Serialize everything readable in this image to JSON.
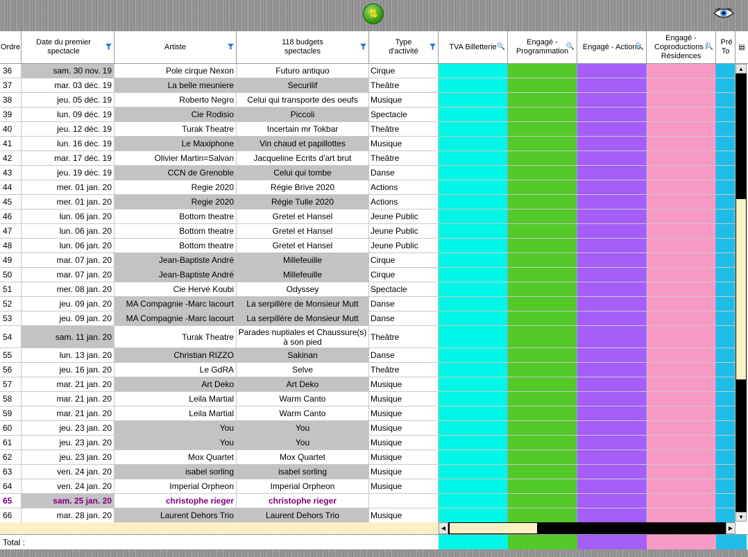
{
  "columns": {
    "ordre": "Ordre",
    "date": "Date du premier spectacle",
    "artiste": "Artiste",
    "budgets": "118 budgets spectacles",
    "type": "Type d'activité",
    "tva": "TVA Billetterie",
    "prog": "Engagé - Programmation",
    "actions": "Engagé - Actions",
    "coprod": "Engagé - Coproductions / Résidences",
    "pre": "Pré To"
  },
  "colors": {
    "tva": "#00f7e7",
    "prog": "#53c92a",
    "actions": "#a55ef7",
    "coprod": "#f79ac6",
    "pre": "#1ebde8"
  },
  "rows": [
    {
      "ordre": "36",
      "date": "sam. 30 nov. 19",
      "artiste": "Pole cirque Nexon",
      "budget": "Futuro antiquo",
      "type": "Cirque",
      "shade": "date"
    },
    {
      "ordre": "37",
      "date": "mar. 03 déc. 19",
      "artiste": "La belle meuniere",
      "budget": "Securilif",
      "type": "Theâtre",
      "shade": "ab"
    },
    {
      "ordre": "38",
      "date": "jeu. 05 déc. 19",
      "artiste": "Roberto Negro",
      "budget": "Celui qui transporte des oeufs",
      "type": "Musique",
      "shade": ""
    },
    {
      "ordre": "39",
      "date": "lun. 09 déc. 19",
      "artiste": "Cie Rodisio",
      "budget": "Piccoli",
      "type": "Spectacle",
      "shade": "ab"
    },
    {
      "ordre": "40",
      "date": "jeu. 12 déc. 19",
      "artiste": "Turak Theatre",
      "budget": "Incertain mr Tokbar",
      "type": "Theâtre",
      "shade": ""
    },
    {
      "ordre": "41",
      "date": "lun. 16 déc. 19",
      "artiste": "Le Maxiphone",
      "budget": "Vin chaud et papillottes",
      "type": "Musique",
      "shade": "ab"
    },
    {
      "ordre": "42",
      "date": "mar. 17 déc. 19",
      "artiste": "Olivier Martin=Salvan",
      "budget": "Jacqueline Ecrits d'art brut",
      "type": "Theâtre",
      "shade": ""
    },
    {
      "ordre": "43",
      "date": "jeu. 19 déc. 19",
      "artiste": "CCN de Grenoble",
      "budget": "Celui qui tombe",
      "type": "Danse",
      "shade": "ab"
    },
    {
      "ordre": "44",
      "date": "mer. 01 jan. 20",
      "artiste": "Regie 2020",
      "budget": "Régie Brive 2020",
      "type": "Actions",
      "shade": ""
    },
    {
      "ordre": "45",
      "date": "mer. 01 jan. 20",
      "artiste": "Regie 2020",
      "budget": "Régie Tulle 2020",
      "type": "Actions",
      "shade": "ab"
    },
    {
      "ordre": "46",
      "date": "lun. 06 jan. 20",
      "artiste": "Bottom theatre",
      "budget": "Gretel et Hansel",
      "type": "Jeune Public",
      "shade": ""
    },
    {
      "ordre": "47",
      "date": "lun. 06 jan. 20",
      "artiste": "Bottom theatre",
      "budget": "Gretel et Hansel",
      "type": "Jeune Public",
      "shade": ""
    },
    {
      "ordre": "48",
      "date": "lun. 06 jan. 20",
      "artiste": "Bottom theatre",
      "budget": "Gretel et Hansel",
      "type": "Jeune Public",
      "shade": ""
    },
    {
      "ordre": "49",
      "date": "mar. 07 jan. 20",
      "artiste": "Jean-Baptiste André",
      "budget": "Millefeuille",
      "type": "Cirque",
      "shade": "ab"
    },
    {
      "ordre": "50",
      "date": "mar. 07 jan. 20",
      "artiste": "Jean-Baptiste André",
      "budget": "Millefeuille",
      "type": "Cirque",
      "shade": "ab"
    },
    {
      "ordre": "51",
      "date": "mer. 08 jan. 20",
      "artiste": "Cie Hervé Koubi",
      "budget": "Odyssey",
      "type": "Spectacle",
      "shade": ""
    },
    {
      "ordre": "52",
      "date": "jeu. 09 jan. 20",
      "artiste": "MA Compagnie -Marc lacourt",
      "budget": "La serpillère de Monsieur Mutt",
      "type": "Danse",
      "shade": "ab"
    },
    {
      "ordre": "53",
      "date": "jeu. 09 jan. 20",
      "artiste": "MA Compagnie -Marc lacourt",
      "budget": "La serpillère de Monsieur Mutt",
      "type": "Danse",
      "shade": "ab"
    },
    {
      "ordre": "54",
      "date": "sam. 11 jan. 20",
      "artiste": "Turak Theatre",
      "budget": "Parades nuptiales et Chaussure(s) à son pied",
      "type": "Theâtre",
      "shade": "date",
      "tall": true
    },
    {
      "ordre": "55",
      "date": "lun. 13 jan. 20",
      "artiste": "Christian RIZZO",
      "budget": "Sakinan",
      "type": "Danse",
      "shade": "ab"
    },
    {
      "ordre": "56",
      "date": "jeu. 16 jan. 20",
      "artiste": "Le GdRA",
      "budget": "Selve",
      "type": "Theâtre",
      "shade": ""
    },
    {
      "ordre": "57",
      "date": "mar. 21 jan. 20",
      "artiste": "Art Deko",
      "budget": "Art Deko",
      "type": "Musique",
      "shade": "ab"
    },
    {
      "ordre": "58",
      "date": "mar. 21 jan. 20",
      "artiste": "Leila Martial",
      "budget": "Warm Canto",
      "type": "Musique",
      "shade": ""
    },
    {
      "ordre": "59",
      "date": "mar. 21 jan. 20",
      "artiste": "Leila Martial",
      "budget": "Warm Canto",
      "type": "Musique",
      "shade": ""
    },
    {
      "ordre": "60",
      "date": "jeu. 23 jan. 20",
      "artiste": "You",
      "budget": "You",
      "type": "Musique",
      "shade": "ab"
    },
    {
      "ordre": "61",
      "date": "jeu. 23 jan. 20",
      "artiste": "You",
      "budget": "You",
      "type": "Musique",
      "shade": "ab"
    },
    {
      "ordre": "62",
      "date": "jeu. 23 jan. 20",
      "artiste": "Mox Quartet",
      "budget": "Mox Quartet",
      "type": "Musique",
      "shade": ""
    },
    {
      "ordre": "63",
      "date": "ven. 24 jan. 20",
      "artiste": "isabel sorling",
      "budget": "isabel sorling",
      "type": "Musique",
      "shade": "ab"
    },
    {
      "ordre": "64",
      "date": "ven. 24 jan. 20",
      "artiste": "Imperial Orpheon",
      "budget": "Imperial Orpheon",
      "type": "Musique",
      "shade": ""
    },
    {
      "ordre": "65",
      "date": "sam. 25 jan. 20",
      "artiste": "christophe rieger",
      "budget": "christophe rieger",
      "type": "",
      "shade": "date",
      "purple": true
    },
    {
      "ordre": "66",
      "date": "mar. 28 jan. 20",
      "artiste": "Laurent Dehors Trio",
      "budget": "Laurent Dehors Trio",
      "type": "Musique",
      "shade": "ab"
    }
  ],
  "total_label": "Total :"
}
